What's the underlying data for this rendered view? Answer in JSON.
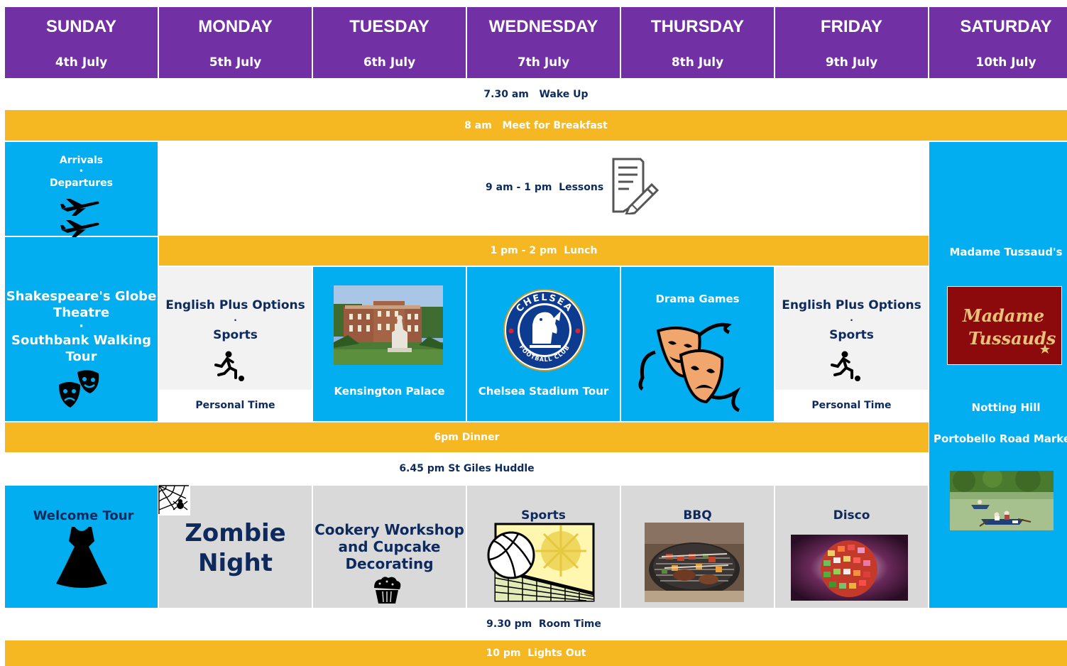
{
  "days": [
    {
      "name": "SUNDAY",
      "date": "4th July"
    },
    {
      "name": "MONDAY",
      "date": "5th July"
    },
    {
      "name": "TUESDAY",
      "date": "6th July"
    },
    {
      "name": "WEDNESDAY",
      "date": "7th July"
    },
    {
      "name": "THURSDAY",
      "date": "8th July"
    },
    {
      "name": "FRIDAY",
      "date": "9th July"
    },
    {
      "name": "SATURDAY",
      "date": "10th July"
    }
  ],
  "rows": {
    "wake_up": "7.30 am   Wake Up",
    "breakfast": "8 am   Meet for Breakfast",
    "lessons": "9 am - 1 pm  Lessons",
    "lunch": "1 pm - 2 pm  Lunch",
    "dinner": "6pm Dinner",
    "huddle": "6.45 pm St Giles Huddle",
    "room_time": "9.30 pm  Room Time",
    "lights_out": "10 pm  Lights Out"
  },
  "sunday": {
    "arrivals": "Arrivals",
    "bullet": "•",
    "departures": "Departures",
    "globe_line1": "Shakespeare's Globe",
    "globe_line2": "Theatre",
    "dot": "·",
    "southbank_line1": "Southbank Walking",
    "southbank_line2": "Tour",
    "welcome_tour": "Welcome Tour"
  },
  "monday": {
    "options": "English Plus Options",
    "dot": "·",
    "sports": "Sports",
    "personal": "Personal Time",
    "evening_line1": "Zombie",
    "evening_line2": "Night"
  },
  "tuesday": {
    "afternoon": "Kensington Palace",
    "evening_line1": "Cookery Workshop",
    "evening_line2": "and Cupcake",
    "evening_line3": "Decorating"
  },
  "wednesday": {
    "afternoon": "Chelsea Stadium Tour",
    "badge_top": "CHELSEA",
    "badge_bottom": "FOOTBALL CLUB",
    "evening": "Sports"
  },
  "thursday": {
    "afternoon": "Drama Games",
    "evening": "BBQ"
  },
  "friday": {
    "options": "English Plus Options",
    "dot": "·",
    "sports": "Sports",
    "personal": "Personal Time",
    "evening": "Disco"
  },
  "saturday": {
    "tussauds": "Madame Tussaud's",
    "logo_text_1": "Madame",
    "logo_text_2": "Tussauds",
    "notting_hill": "Notting Hill",
    "portobello": "Portobello Road Market"
  },
  "colors": {
    "purple": "#7130a3",
    "blue": "#02aeef",
    "gold": "#f5b722",
    "navy": "#0e2a5d",
    "light_gray": "#f2f2f2",
    "mid_gray": "#d9d9d9"
  }
}
